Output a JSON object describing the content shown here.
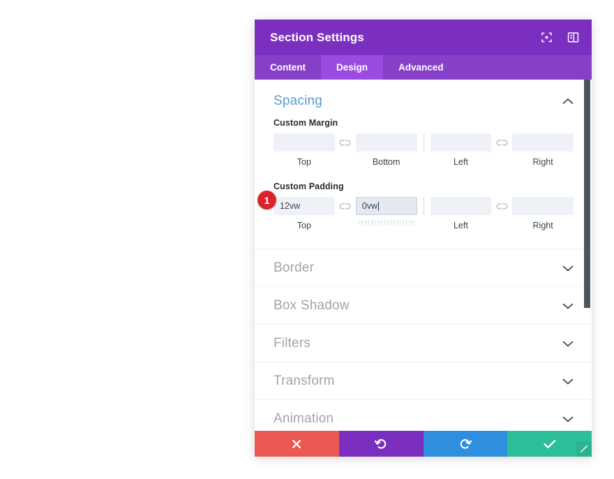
{
  "window": {
    "title": "Section Settings",
    "header_icons": [
      {
        "name": "expand-view-icon",
        "label": "Expand view"
      },
      {
        "name": "panel-layout-icon",
        "label": "Panel layout"
      }
    ]
  },
  "tabs": [
    {
      "id": "content",
      "label": "Content",
      "active": false
    },
    {
      "id": "design",
      "label": "Design",
      "active": true
    },
    {
      "id": "advanced",
      "label": "Advanced",
      "active": false
    }
  ],
  "spacing": {
    "title": "Spacing",
    "expanded": true,
    "chevron": "chevron-up-icon",
    "custom_margin": {
      "label": "Custom Margin",
      "fields": [
        {
          "caption": "Top",
          "value": "",
          "placeholder": "",
          "focused": false
        },
        {
          "caption": "Bottom",
          "value": "",
          "placeholder": "",
          "focused": false
        },
        {
          "caption": "Left",
          "value": "",
          "placeholder": "",
          "focused": false
        },
        {
          "caption": "Right",
          "value": "",
          "placeholder": "",
          "focused": false
        }
      ],
      "link_icon": "broken-link-icon"
    },
    "custom_padding": {
      "label": "Custom Padding",
      "fields": [
        {
          "caption": "Top",
          "value": "12vw",
          "placeholder": "",
          "focused": false
        },
        {
          "caption": "",
          "value": "0vw",
          "placeholder": "",
          "focused": true
        },
        {
          "caption": "Left",
          "value": "",
          "placeholder": "",
          "focused": false
        },
        {
          "caption": "Right",
          "value": "",
          "placeholder": "",
          "focused": false
        }
      ],
      "link_icon": "broken-link-icon",
      "step_badge": "1"
    }
  },
  "collapsed_sections": [
    {
      "id": "border",
      "label": "Border",
      "chevron": "chevron-down-icon"
    },
    {
      "id": "box-shadow",
      "label": "Box Shadow",
      "chevron": "chevron-down-icon"
    },
    {
      "id": "filters",
      "label": "Filters",
      "chevron": "chevron-down-icon"
    },
    {
      "id": "transform",
      "label": "Transform",
      "chevron": "chevron-down-icon"
    },
    {
      "id": "animation",
      "label": "Animation",
      "chevron": "chevron-down-icon"
    }
  ],
  "footer": [
    {
      "id": "cancel",
      "icon": "close-x-icon",
      "label": "Cancel"
    },
    {
      "id": "undo",
      "icon": "undo-icon",
      "label": "Undo"
    },
    {
      "id": "redo",
      "icon": "redo-icon",
      "label": "Redo"
    },
    {
      "id": "save",
      "icon": "checkmark-icon",
      "label": "Save Changes"
    }
  ],
  "resize_handle": {
    "name": "resize-grip",
    "label": "Resize"
  },
  "colors": {
    "titlebar": "#7b2fbe",
    "tabbar": "#8540c7",
    "tab_active": "#9a4ce0",
    "section_title": "#5c9ccd",
    "collapsed_title": "#9ea4ad",
    "input_bg": "#eef1f6",
    "badge": "#d9232d",
    "cancel": "#eb5a52",
    "undo": "#7b2fbe",
    "redo": "#2d8fdd",
    "save": "#2cbf9a",
    "scrollbar_thumb": "#4a5560"
  }
}
